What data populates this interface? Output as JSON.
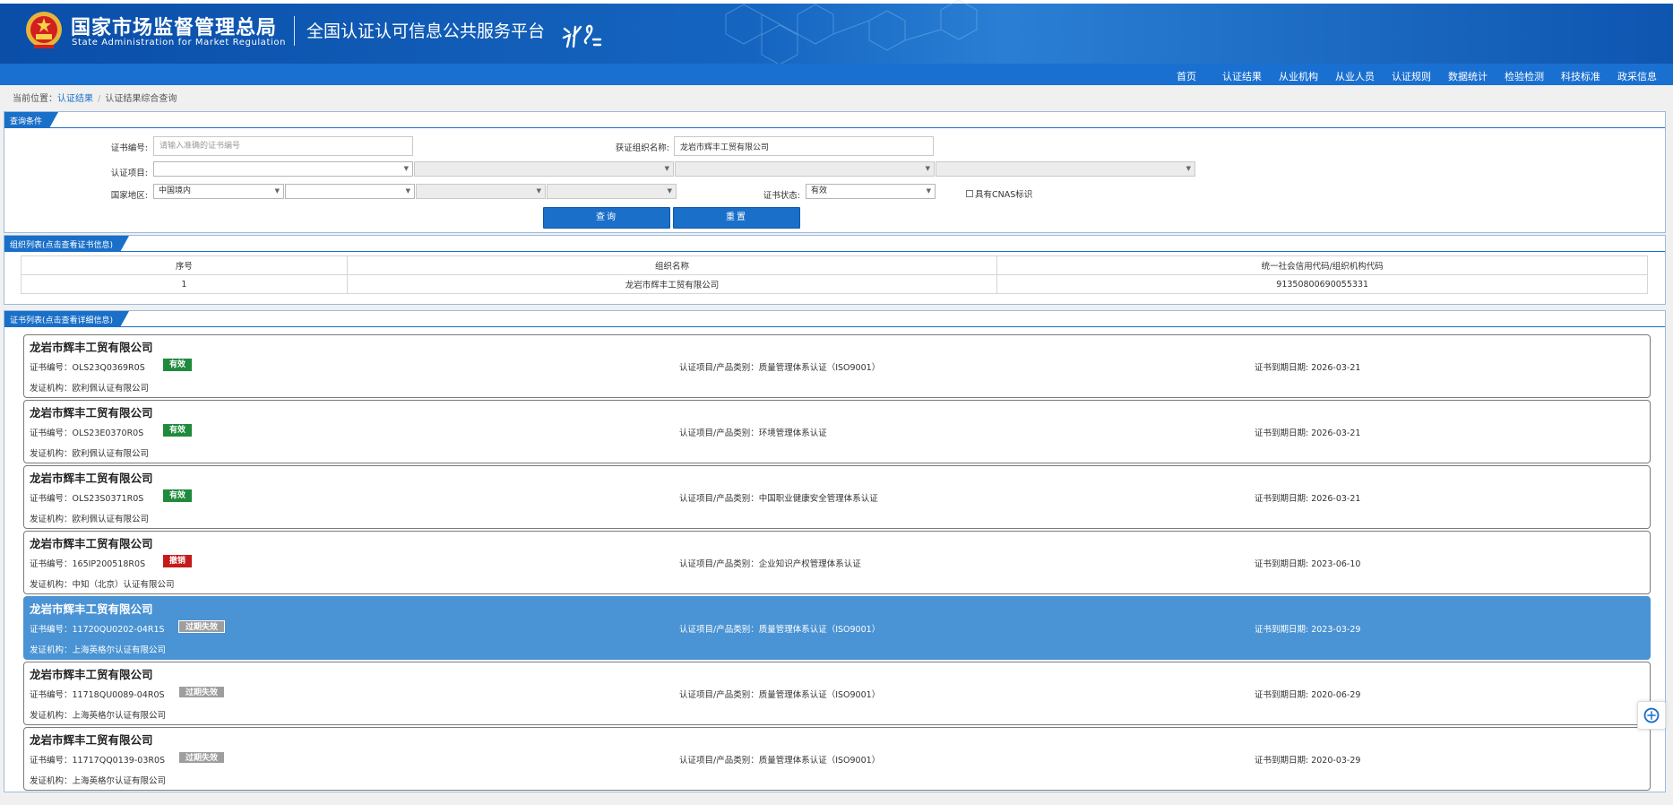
{
  "header": {
    "agency_cn": "国家市场监督管理总局",
    "agency_en": "State Administration for Market Regulation",
    "platform": "全国认证认可信息公共服务平台"
  },
  "nav": [
    "首页",
    "认证结果",
    "从业机构",
    "从业人员",
    "认证规则",
    "数据统计",
    "检验检测",
    "科技标准",
    "政采信息"
  ],
  "breadcrumb": {
    "prefix": "当前位置：",
    "link": "认证结果",
    "sep": "/",
    "current": "认证结果综合查询"
  },
  "query": {
    "title": "查询条件",
    "cert_no_label": "证书编号:",
    "cert_no_placeholder": "请输入准确的证书编号",
    "cert_no_value": "",
    "org_label": "获证组织名称:",
    "org_value": "龙岩市辉丰工贸有限公司",
    "project_label": "认证项目:",
    "region_label": "国家地区:",
    "region_value": "中国境内",
    "status_label": "证书状态:",
    "status_value": "有效",
    "cnas_label": "具有CNAS标识",
    "search_btn": "查询",
    "reset_btn": "重置"
  },
  "org_list": {
    "title": "组织列表(点击查看证书信息)",
    "headers": [
      "序号",
      "组织名称",
      "统一社会信用代码/组织机构代码"
    ],
    "rows": [
      [
        "1",
        "龙岩市辉丰工贸有限公司",
        "91350800690055331"
      ]
    ]
  },
  "cert_list": {
    "title": "证书列表(点击查看详细信息)",
    "items": [
      {
        "name": "龙岩市辉丰工贸有限公司",
        "no": "证书编号：OLS23Q0369R0S",
        "status": "有效",
        "status_type": "valid",
        "project": "认证项目/产品类别：质量管理体系认证（ISO9001）",
        "expiry": "证书到期日期: 2026-03-21",
        "org": "发证机构：欧利佩认证有限公司"
      },
      {
        "name": "龙岩市辉丰工贸有限公司",
        "no": "证书编号：OLS23E0370R0S",
        "status": "有效",
        "status_type": "valid",
        "project": "认证项目/产品类别：环境管理体系认证",
        "expiry": "证书到期日期: 2026-03-21",
        "org": "发证机构：欧利佩认证有限公司"
      },
      {
        "name": "龙岩市辉丰工贸有限公司",
        "no": "证书编号：OLS23S0371R0S",
        "status": "有效",
        "status_type": "valid",
        "project": "认证项目/产品类别：中国职业健康安全管理体系认证",
        "expiry": "证书到期日期: 2026-03-21",
        "org": "发证机构：欧利佩认证有限公司"
      },
      {
        "name": "龙岩市辉丰工贸有限公司",
        "no": "证书编号：165IP200518R0S",
        "status": "撤销",
        "status_type": "revoked",
        "project": "认证项目/产品类别：企业知识产权管理体系认证",
        "expiry": "证书到期日期: 2023-06-10",
        "org": "发证机构：中知（北京）认证有限公司"
      },
      {
        "name": "龙岩市辉丰工贸有限公司",
        "no": "证书编号：11720QU0202-04R1S",
        "status": "过期失效",
        "status_type": "expired",
        "project": "认证项目/产品类别：质量管理体系认证（ISO9001）",
        "expiry": "证书到期日期: 2023-03-29",
        "org": "发证机构：上海英格尔认证有限公司",
        "active": true
      },
      {
        "name": "龙岩市辉丰工贸有限公司",
        "no": "证书编号：11718QU0089-04R0S",
        "status": "过期失效",
        "status_type": "expired",
        "project": "认证项目/产品类别：质量管理体系认证（ISO9001）",
        "expiry": "证书到期日期: 2020-06-29",
        "org": "发证机构：上海英格尔认证有限公司"
      },
      {
        "name": "龙岩市辉丰工贸有限公司",
        "no": "证书编号：11717QQ0139-03R0S",
        "status": "过期失效",
        "status_type": "expired",
        "project": "认证项目/产品类别：质量管理体系认证（ISO9001）",
        "expiry": "证书到期日期: 2020-03-29",
        "org": "发证机构：上海英格尔认证有限公司"
      }
    ]
  },
  "colors": {
    "header_blue": "#0a4ea8",
    "nav_blue": "#1a70d0",
    "valid": "#1f8a3c",
    "revoked": "#c61a1a",
    "expired": "#9e9e9e",
    "active_row": "#4a93d4"
  },
  "icons": [
    "national-emblem-icon",
    "platform-logo-icon",
    "float-service-icon"
  ]
}
